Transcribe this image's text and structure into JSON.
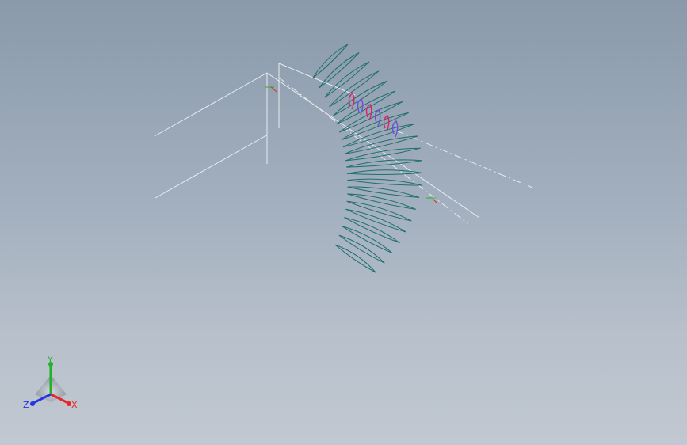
{
  "scene": {
    "background_top": "#8a9aab",
    "background_bottom": "#c1c8d1",
    "wire_color": "#e8ecf0",
    "part_edge_color": "#1f6f6a",
    "highlight_color": "#d6246f",
    "highlight_alt_color": "#6b4fd8"
  },
  "triad": {
    "x_label": "X",
    "y_label": "Y",
    "z_label": "Z",
    "x_color": "#e8262a",
    "y_color": "#22b229",
    "z_color": "#2636e0"
  }
}
